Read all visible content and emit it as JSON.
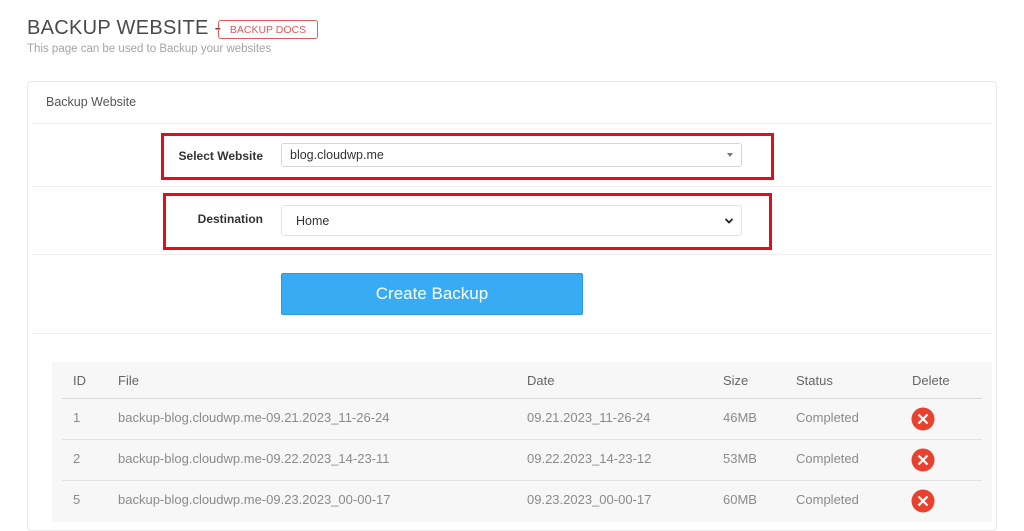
{
  "header": {
    "title": "BACKUP WEBSITE -",
    "docs_badge": "BACKUP DOCS",
    "subtitle": "This page can be used to Backup your websites"
  },
  "panel": {
    "heading": "Backup Website"
  },
  "form": {
    "website_label": "Select Website",
    "website_value": "blog.cloudwp.me",
    "destination_label": "Destination",
    "destination_value": "Home",
    "create_button": "Create Backup"
  },
  "table": {
    "columns": [
      "ID",
      "File",
      "Date",
      "Size",
      "Status",
      "Delete"
    ],
    "rows": [
      {
        "id": "1",
        "file": "backup-blog.cloudwp.me-09.21.2023_11-26-24",
        "date": "09.21.2023_11-26-24",
        "size": "46MB",
        "status": "Completed"
      },
      {
        "id": "2",
        "file": "backup-blog.cloudwp.me-09.22.2023_14-23-11",
        "date": "09.22.2023_14-23-12",
        "size": "53MB",
        "status": "Completed"
      },
      {
        "id": "5",
        "file": "backup-blog.cloudwp.me-09.23.2023_00-00-17",
        "date": "09.23.2023_00-00-17",
        "size": "60MB",
        "status": "Completed"
      }
    ]
  },
  "colors": {
    "accent": "#38abf5",
    "highlight": "#e0101a",
    "delete": "#e8412e",
    "badge": "#e05a5a"
  },
  "icons": {
    "delete": "delete-x-icon",
    "dropdown": "chevron-down-icon"
  }
}
